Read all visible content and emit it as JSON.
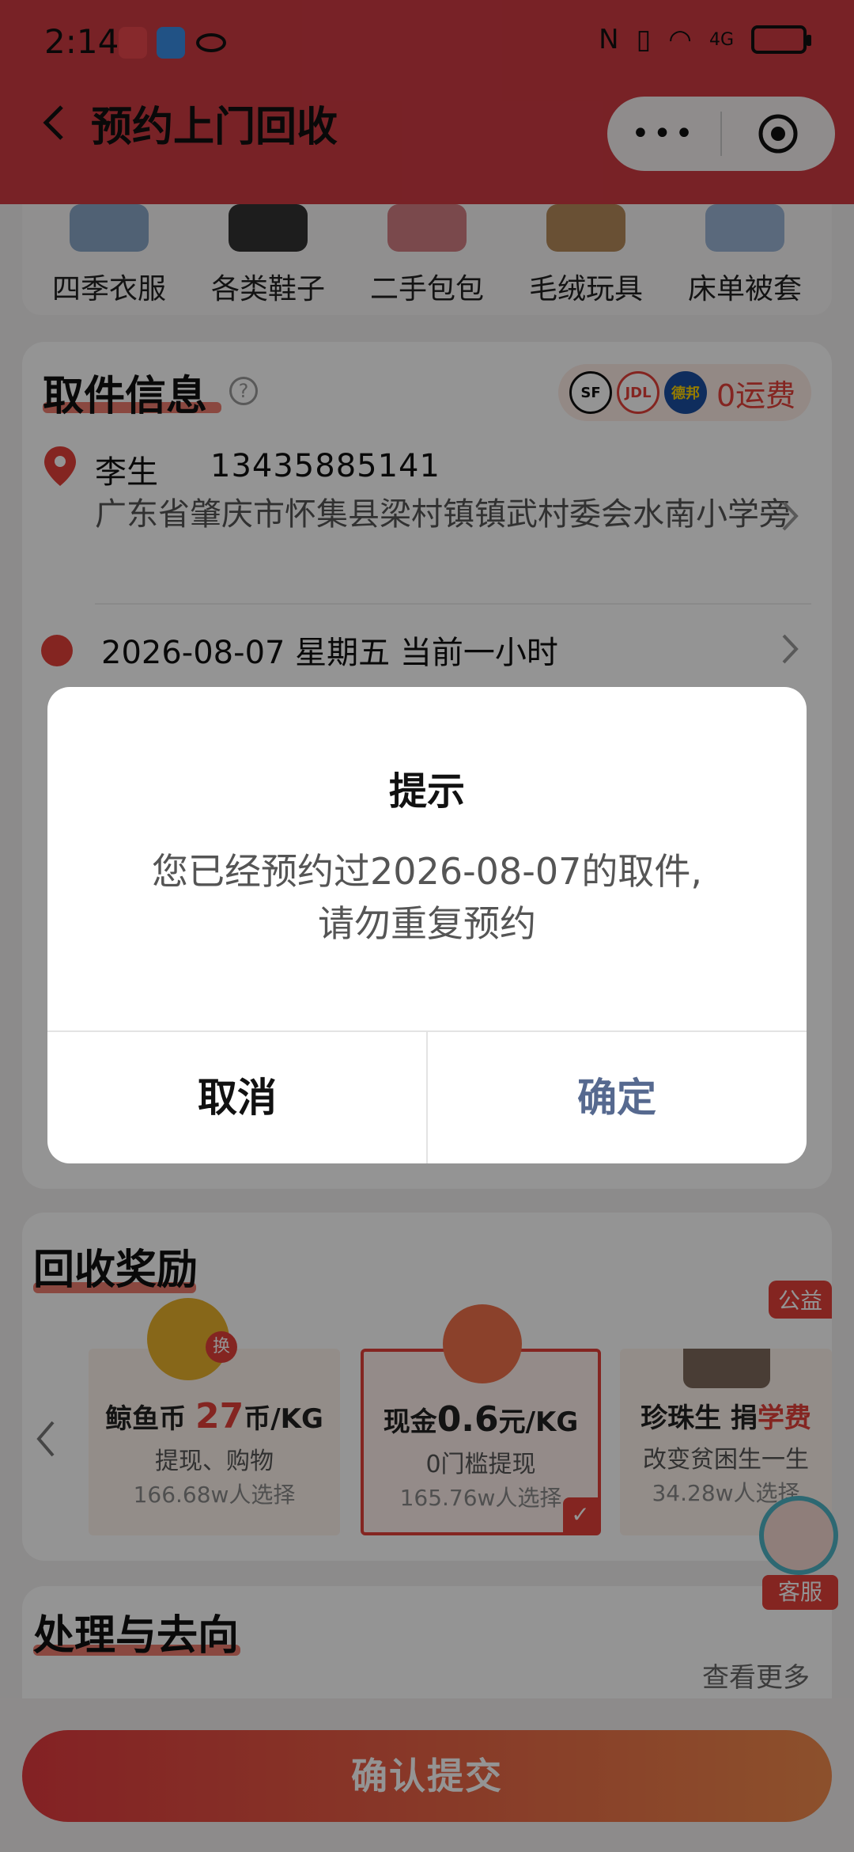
{
  "status": {
    "time": "2:14",
    "network": "4G"
  },
  "header": {
    "title": "预约上门回收"
  },
  "categories": [
    {
      "label": "四季衣服"
    },
    {
      "label": "各类鞋子"
    },
    {
      "label": "二手包包"
    },
    {
      "label": "毛绒玩具"
    },
    {
      "label": "床单被套"
    }
  ],
  "pickup": {
    "title": "取件信息",
    "carriers": [
      "SF",
      "JDL",
      "德邦"
    ],
    "free_shipping": "0运费",
    "name": "李生",
    "phone": "13435885141",
    "address": "广东省肇庆市怀集县梁村镇镇武村委会水南小学旁",
    "datetime": "2026-08-07 星期五 当前一小时"
  },
  "reward": {
    "title": "回收奖励",
    "items": [
      {
        "name": "鲸鱼币",
        "rate": "27",
        "unit": "币/KG",
        "desc": "提现、购物",
        "chosen": "166.68w人选择",
        "badge": "换"
      },
      {
        "name": "现金",
        "rate": "0.6",
        "unit": "元/KG",
        "desc": "0门槛提现",
        "chosen": "165.76w人选择"
      },
      {
        "name": "珍珠生 捐",
        "rate": "学费",
        "desc": "改变贫困生一生",
        "chosen": "34.28w人选择",
        "tag": "公益"
      }
    ]
  },
  "process": {
    "title": "处理与去向",
    "see_more": "查看更多"
  },
  "customer_service": "客服",
  "submit_label": "确认提交",
  "dialog": {
    "title": "提示",
    "message_line1": "您已经预约过2026-08-07的取件,",
    "message_line2": "请勿重复预约",
    "cancel": "取消",
    "confirm": "确定"
  }
}
